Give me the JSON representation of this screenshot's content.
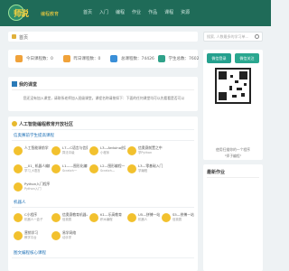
{
  "brand": {
    "logo_text": "师说",
    "subtitle": "编程教育",
    "accent": "#1f6b58"
  },
  "nav": [
    "首页",
    "入门",
    "编程",
    "作业",
    "作品",
    "课程",
    "资源"
  ],
  "breadcrumb": "首页",
  "search": {
    "placeholder": "搜索, 人数最多的学习单..."
  },
  "stats": [
    {
      "label": "今日课程数：0",
      "color": "#f0a23a"
    },
    {
      "label": "昨日课程数：0",
      "color": "#f0a23a"
    },
    {
      "label": "总课程数：74426",
      "color": "#3a8fd8"
    },
    {
      "label": "学生总数：7602",
      "color": "#30a28a"
    }
  ],
  "announcement": {
    "title": "我的课堂",
    "text": "您还没有加入课堂，请联系老师加入班级课堂。课程名称请按如下：下面的任何课堂均可以先看看是否可以"
  },
  "courses": {
    "title": "人工智能编程教育开放社区",
    "sections": [
      {
        "title": "信奥赛前学生提高课程",
        "cards": [
          {
            "name": "人工智能课前学",
            "desc": ""
          },
          {
            "name": "L7—C语言与信奥赛",
            "desc": "算法中级"
          },
          {
            "name": "L3—Arduino创客",
            "desc": "小程序"
          },
          {
            "name": "信奥赛前置之中",
            "desc": "学Python"
          },
          {
            "name": "__01_ 机器人编程",
            "desc": "学习_K语言"
          },
          {
            "name": "L1——图形化编程",
            "desc": "Scratch一"
          },
          {
            "name": "L2—图形编程一",
            "desc": "Scratch—"
          },
          {
            "name": "L3—零基础入门",
            "desc": "学编程"
          },
          {
            "name": "Python入门程序",
            "desc": "Python入门"
          }
        ]
      },
      {
        "title": "机器人",
        "cards": [
          {
            "name": "C小程序",
            "desc": "机器人一盒子"
          },
          {
            "name": "信奥赛教育机器人",
            "desc": "信奥赛"
          },
          {
            "name": "K1—乐高教育",
            "desc": "积木编程"
          },
          {
            "name": "U5—拼搏一站",
            "desc": "机器人"
          },
          {
            "name": "S5—拼搏一站",
            "desc": "信奥赛"
          },
          {
            "name": "营销学习",
            "desc": "教学平台"
          },
          {
            "name": "易学网络",
            "desc": "动手学"
          }
        ]
      },
      {
        "title": "图文编程核心课程",
        "cards": []
      }
    ]
  },
  "qr": {
    "tab1": "微信登录",
    "tab2": "微信关注",
    "caption1": "使用扫描你的一个程序",
    "caption2": "\"师子编程\""
  },
  "homework": {
    "title": "最新作业"
  }
}
